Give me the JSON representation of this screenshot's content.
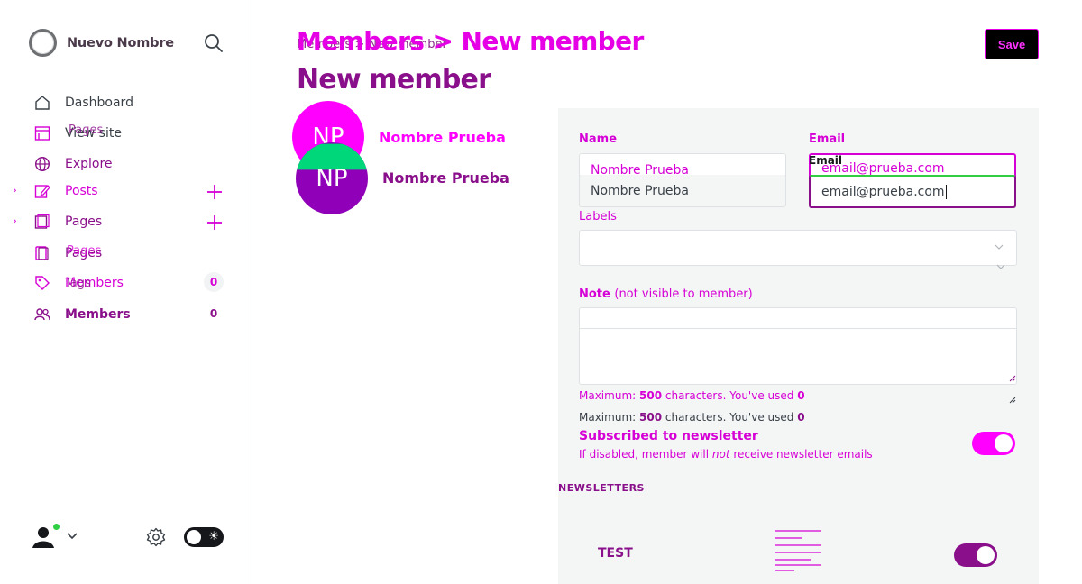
{
  "sidebar": {
    "brand": "Nuevo Nombre",
    "nav": {
      "dashboard": "Dashboard",
      "view_site": "View site",
      "explore": "Explore",
      "posts": "Posts",
      "pages": "Pages",
      "tags": "Tags",
      "members": "Members",
      "members_count": "0",
      "ghost_pages_a": "Pages",
      "ghost_pages_b": "Pages",
      "ghost_tags": "Tags",
      "ghost_members": "Members",
      "ghost_members_count": "0"
    }
  },
  "header": {
    "breadcrumb_small": "Members  >  New member",
    "breadcrumb_big": "Members  >  New member",
    "title": "New member",
    "save_label": "Save"
  },
  "member": {
    "initials": "NP",
    "name": "Nombre Prueba"
  },
  "form": {
    "name_label": "Name",
    "name_value": "Nombre Prueba",
    "email_label": "Email",
    "email_value": "email@prueba.com",
    "labels_label": "Labels",
    "note_label": "Note",
    "note_suffix": "(not visible to member)",
    "note_hint_prefix": "Maximum:",
    "note_hint_max": "500",
    "note_hint_mid": "characters. You've used",
    "note_hint_used": "0",
    "subscribed_title": "Subscribed to newsletter",
    "subscribed_desc_a": "If disabled, member will",
    "subscribed_desc_not": "not",
    "subscribed_desc_b": "receive newsletter emails",
    "subscribed_on": true
  },
  "newsletters": {
    "heading": "NEWSLETTERS",
    "items": [
      {
        "name": "TEST",
        "enabled": true
      }
    ]
  },
  "colors": {
    "accent_pink": "#ff00ff",
    "accent_purple": "#8a0f8a",
    "status_green": "#30cf43"
  }
}
